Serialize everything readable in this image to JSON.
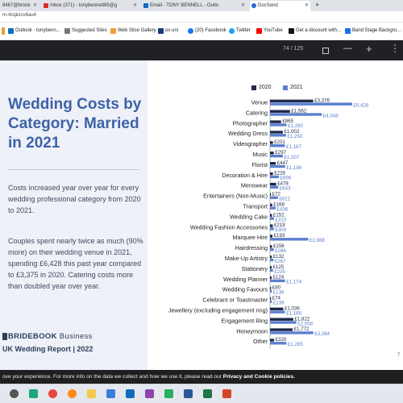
{
  "browser": {
    "tabs": [
      {
        "label": "8467@brook",
        "color": "#1a73e8"
      },
      {
        "label": "Inbox (371) - tonybennett85@g",
        "color": "#d93025"
      },
      {
        "label": "Email - TONY BENNELL - Outlo",
        "color": "#0f6cbd"
      },
      {
        "label": "DocSend",
        "color": "#2a66d9",
        "active": true
      }
    ],
    "new_tab": "+",
    "url": "m-4cqkzcv6au4",
    "bookmarks": [
      {
        "label": "Outlook - tonybenn...",
        "color": "#0f6cbd"
      },
      {
        "label": "Suggested Sites",
        "color": "#7a7a7a"
      },
      {
        "label": "Web Slice Gallery",
        "color": "#f0a030"
      },
      {
        "label": "ox uni",
        "color": "#1a3a7a"
      },
      {
        "label": "(20) Facebook",
        "color": "#1877f2"
      },
      {
        "label": "Twitter",
        "color": "#1da1f2"
      },
      {
        "label": "YouTube",
        "color": "#ff0000"
      },
      {
        "label": "Get a discount with...",
        "color": "#111111"
      },
      {
        "label": "Band Stage Backgro...",
        "color": "#1a73e8"
      }
    ]
  },
  "viewer": {
    "page_indicator": "74 / 125",
    "minus": "—",
    "plus": "+"
  },
  "slide": {
    "title": "Wedding Costs by Category: Married in 2021",
    "para1": "Costs increased year over year for every wedding professional category from 2020 to 2021.",
    "para2": "Couples spent nearly twice as much (90% more) on their wedding venue in 2021, spending £6,428 this past year compared to £3,375 in 2020. Catering costs more than doubled year over year.",
    "brand_bold": "BRIDEBOOK",
    "brand_rest": "Business",
    "report": "UK Wedding Report | 2022",
    "page_number": "7"
  },
  "chart_data": {
    "type": "bar",
    "orientation": "horizontal",
    "categories": [
      "Venue",
      "Catering",
      "Photographer",
      "Wedding Dress",
      "Videographer",
      "Music",
      "Florist",
      "Decoration & Hire",
      "Menswear",
      "Entertainers (Non-Music)",
      "Transport",
      "Wedding Cake",
      "Wedding Fashion Accessories",
      "Marquee Hire",
      "Hairdressing",
      "Make-Up Artistry",
      "Stationery",
      "Wedding Planner",
      "Wedding Favours",
      "Celebrant or Toastmaster",
      "Jewellery (excluding engagement ring)",
      "Engagement Ring",
      "Honeymoon",
      "Other"
    ],
    "series": [
      {
        "name": "2020",
        "color": "#1e2a48",
        "values": [
          3376,
          1562,
          865,
          1002,
          231,
          297,
          447,
          228,
          478,
          72,
          168,
          152,
          219,
          193,
          156,
          132,
          125,
          124,
          80,
          74,
          1036,
          1822,
          1772,
          320
        ],
        "labels": [
          "£3,376",
          "£1,562",
          "£865",
          "£1,002",
          "£231",
          "£297",
          "£447",
          "£228",
          "£478",
          "£72",
          "£168",
          "£152",
          "£219",
          "£193",
          "£156",
          "£132",
          "£125",
          "£124",
          "£80",
          "£74",
          "£1,036",
          "£1,822",
          "£1,772",
          "£320"
        ]
      },
      {
        "name": "2021",
        "color": "#5b7fce",
        "values": [
          6428,
          4048,
          1290,
          1250,
          1167,
          1007,
          1186,
          696,
          643,
          621,
          436,
          310,
          300,
          2988,
          286,
          267,
          235,
          1174,
          138,
          139,
          1168,
          2058,
          3384,
          1285
        ],
        "labels": [
          "£6,428",
          "£4,048",
          "£1,290",
          "£1,250",
          "£1,167",
          "£1,007",
          "£1,186",
          "£696",
          "£643",
          "£621",
          "£436",
          "£310",
          "£300",
          "£2,988",
          "£286",
          "£267",
          "£235",
          "£1,174",
          "£138",
          "£139",
          "£1,168",
          "£2,058",
          "£3,384",
          "£1,285"
        ]
      }
    ],
    "legend_position": "top",
    "grid": false
  },
  "cookie_bar": {
    "text": "ove your experience. For more info on the data we collect and how we use it, please read our ",
    "link": "Privacy and Cookie policies."
  },
  "taskbar": {
    "icons": [
      {
        "name": "search",
        "color": "#555555"
      },
      {
        "name": "edge",
        "color": "#1fa67a"
      },
      {
        "name": "chrome",
        "color": "#e8453c"
      },
      {
        "name": "firefox",
        "color": "#ff8a16"
      },
      {
        "name": "folder",
        "color": "#f2c94c"
      },
      {
        "name": "store",
        "color": "#3b7ddd"
      },
      {
        "name": "mail",
        "color": "#0f6cbd"
      },
      {
        "name": "media",
        "color": "#8e44ad"
      },
      {
        "name": "app",
        "color": "#27ae60"
      },
      {
        "name": "word",
        "color": "#2b579a"
      },
      {
        "name": "excel",
        "color": "#217346"
      },
      {
        "name": "powerpoint",
        "color": "#d24726"
      }
    ]
  }
}
